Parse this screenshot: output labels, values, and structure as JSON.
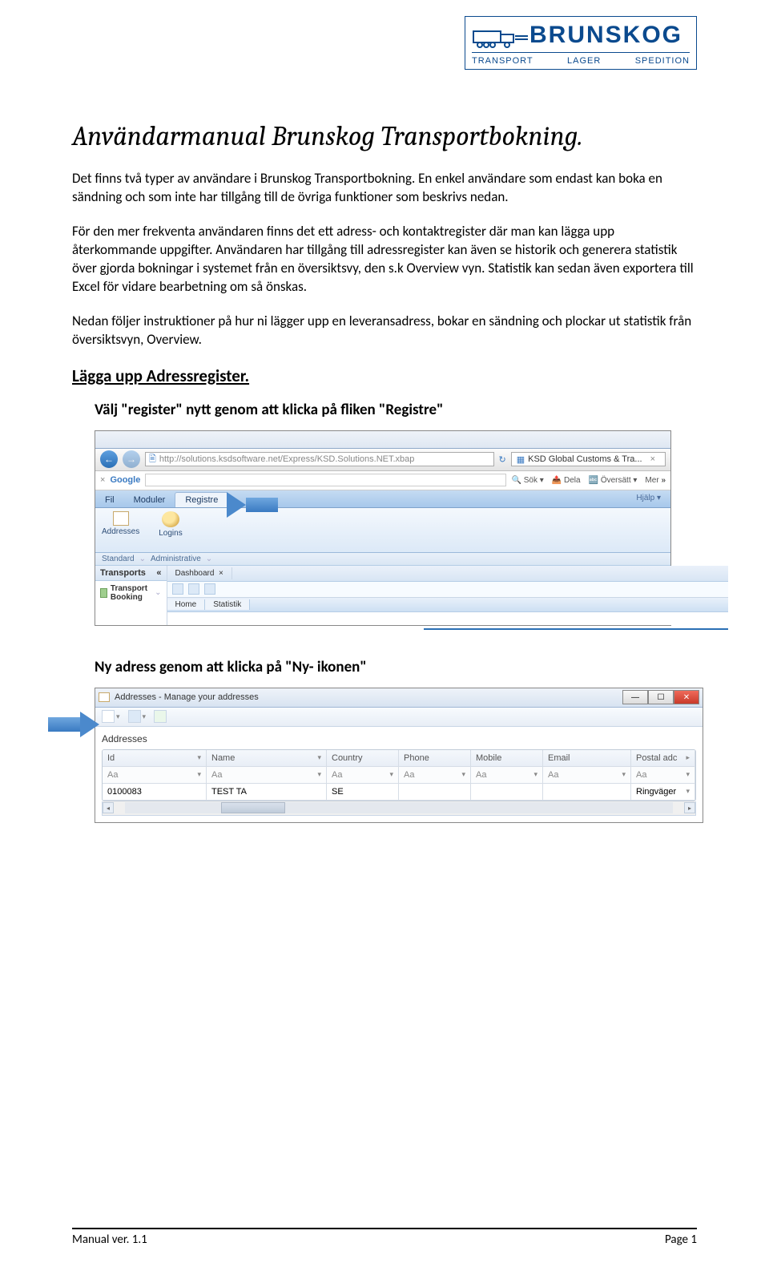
{
  "logo": {
    "company": "BRUNSKOG",
    "tags": [
      "TRANSPORT",
      "LAGER",
      "SPEDITION"
    ]
  },
  "title": "Användarmanual Brunskog Transportbokning.",
  "para1": "Det finns två typer av användare i Brunskog Transportbokning. En enkel användare som endast kan boka en sändning och som inte har tillgång till de övriga funktioner som beskrivs nedan.",
  "para2": "För den mer frekventa användaren finns det ett adress- och kontaktregister där man kan lägga upp återkommande uppgifter. Användaren har tillgång till adressregister kan även se historik och generera statistik över gjorda bokningar i systemet från en översiktsvy, den s.k Overview vyn. Statistik kan sedan även exportera till Excel för vidare bearbetning om så önskas.",
  "para3": "Nedan följer instruktioner på hur ni lägger upp en leveransadress, bokar en sändning och plockar ut statistik från översiktsvyn, Overview.",
  "section1": "Lägga upp Adressregister.",
  "step1": "Välj \"register\" nytt genom att klicka på fliken \"Registre\"",
  "step2": "Ny adress genom att klicka på \"Ny- ikonen\"",
  "shot1": {
    "url": "http://solutions.ksdsoftware.net/Express/KSD.Solutions.NET.xbap",
    "browser_tab": "KSD Global Customs & Tra...",
    "google_label": "Google",
    "google_buttons": [
      "Sök",
      "Dela",
      "Översätt",
      "Mer"
    ],
    "help": "Hjälp",
    "ribbon_tabs": [
      "Fil",
      "Moduler",
      "Registre"
    ],
    "rib_items": [
      {
        "label": "Addresses"
      },
      {
        "label": "Logins"
      }
    ],
    "groups": [
      "Standard",
      "Administrative"
    ],
    "left_header": "Transports",
    "left_item": "Transport Booking",
    "dash_tab": "Dashboard",
    "inner_tabs": [
      "Home",
      "Statistik"
    ]
  },
  "shot2": {
    "window_title": "Addresses - Manage your addresses",
    "panel_title": "Addresses",
    "columns": [
      "Id",
      "Name",
      "Country",
      "Phone",
      "Mobile",
      "Email",
      "Postal adc"
    ],
    "filter_label": "Aa",
    "row": {
      "id": "0100083",
      "name": "TEST TA",
      "country": "SE",
      "phone": "",
      "mobile": "",
      "email": "",
      "postal": "Ringväger"
    }
  },
  "footer": {
    "left": "Manual ver. 1.1",
    "right": "Page 1"
  }
}
